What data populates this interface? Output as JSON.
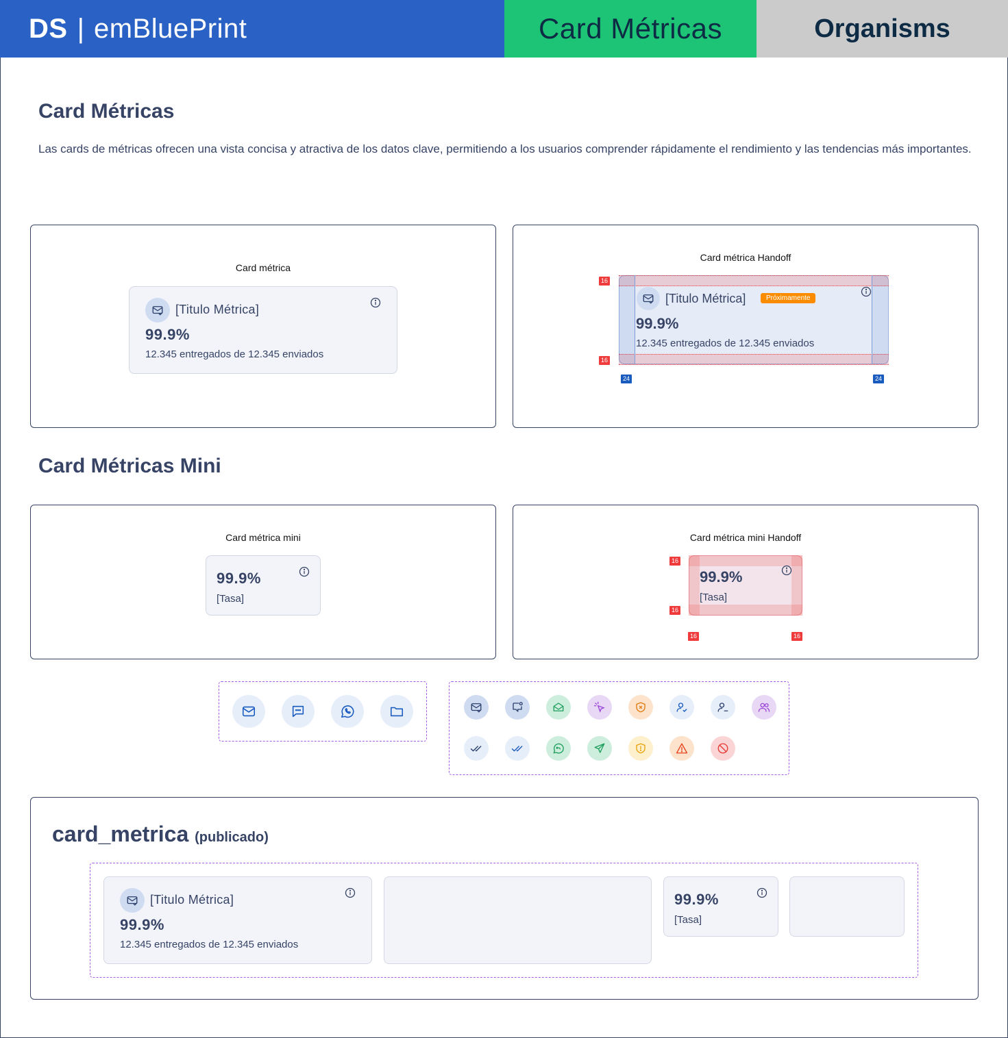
{
  "header": {
    "brand_short": "DS",
    "brand_separator": "|",
    "brand_name": "emBluePrint",
    "page_name": "Card Métricas",
    "category": "Organisms",
    "colors": {
      "brand_bg": "#2962c4",
      "page_bg": "#1ec476",
      "category_bg": "#cbcbcb"
    }
  },
  "intro": {
    "title": "Card Métricas",
    "description": "Las cards de métricas ofrecen una vista concisa y atractiva de los datos clave, permitiendo a los usuarios comprender rápidamente el rendimiento y las tendencias más importantes."
  },
  "card_metrica": {
    "label": "Card métrica",
    "icon": "mail-check-icon",
    "title": "[Titulo Métrica]",
    "value": "99.9%",
    "subtitle": "12.345 entregados de 12.345 enviados"
  },
  "card_metrica_handoff": {
    "label": "Card métrica Handoff",
    "title": "[Titulo Métrica]",
    "badge": "Próximamente",
    "value": "99.9%",
    "subtitle": "12.345 entregados de 12.345 enviados",
    "spacing_vertical": "16",
    "spacing_horizontal": "24"
  },
  "mini_section": {
    "title": "Card Métricas Mini"
  },
  "card_mini": {
    "label": "Card métrica mini",
    "value": "99.9%",
    "caption": "[Tasa]"
  },
  "card_mini_handoff": {
    "label": "Card métrica mini Handoff",
    "value": "99.9%",
    "caption": "[Tasa]",
    "spacing": "16"
  },
  "icon_sets": {
    "channels": [
      "mail-icon",
      "sms-icon",
      "whatsapp-icon",
      "folder-icon"
    ],
    "metrics_row1": [
      "mail-check-icon",
      "message-notification-icon",
      "mail-open-icon",
      "click-icon",
      "shield-x-icon",
      "user-check-icon",
      "user-minus-icon",
      "users-icon"
    ],
    "metrics_row2": [
      "double-check-icon",
      "double-check-blue-icon",
      "whatsapp-reply-icon",
      "send-icon",
      "shield-alert-icon",
      "warning-icon",
      "blocked-icon"
    ]
  },
  "published": {
    "title": "card_metrica",
    "tag": "(publicado)",
    "card": {
      "title": "[Titulo Métrica]",
      "value": "99.9%",
      "subtitle": "12.345 entregados de 12.345 enviados"
    },
    "mini": {
      "value": "99.9%",
      "caption": "[Tasa]"
    }
  }
}
